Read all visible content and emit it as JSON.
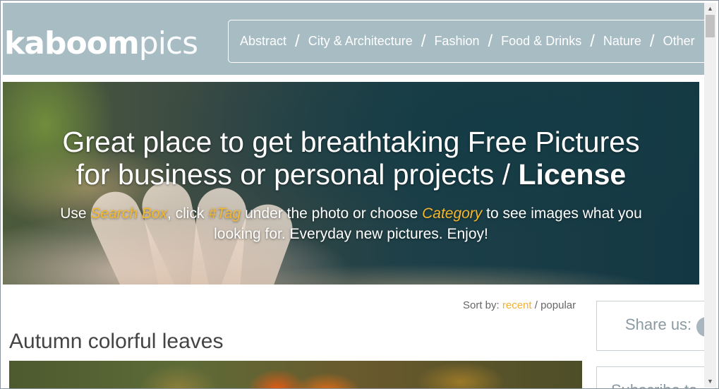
{
  "logo": {
    "bold": "kaboom",
    "light": "pics"
  },
  "nav": {
    "items": [
      {
        "label": "Abstract"
      },
      {
        "label": "City & Architecture"
      },
      {
        "label": "Fashion"
      },
      {
        "label": "Food & Drinks"
      },
      {
        "label": "Nature"
      },
      {
        "label": "Other"
      }
    ],
    "separator": "/"
  },
  "hero": {
    "title_line1": "Great place to get breathtaking Free Pictures",
    "title_line2_prefix": "for business or personal projects / ",
    "title_line2_bold": "License",
    "sub": {
      "p1": "Use ",
      "h1": "Search Box",
      "p2": ", click ",
      "h2": "#Tag",
      "p3": " under the photo or choose ",
      "h3": "Category",
      "p4": " to see images what you looking for. Everyday new pictures. Enjoy!"
    }
  },
  "sort": {
    "label": "Sort by: ",
    "recent": "recent",
    "sep": " / ",
    "popular": "popular"
  },
  "post": {
    "title": "Autumn colorful leaves"
  },
  "sidebar": {
    "share_label": "Share us:",
    "subscribe_label": "Subscribe to"
  },
  "scrollbar": {
    "up": "▲",
    "down": "▼"
  },
  "colors": {
    "header_bg": "#a8bcc4",
    "accent": "#f4b233",
    "text": "#444444"
  }
}
